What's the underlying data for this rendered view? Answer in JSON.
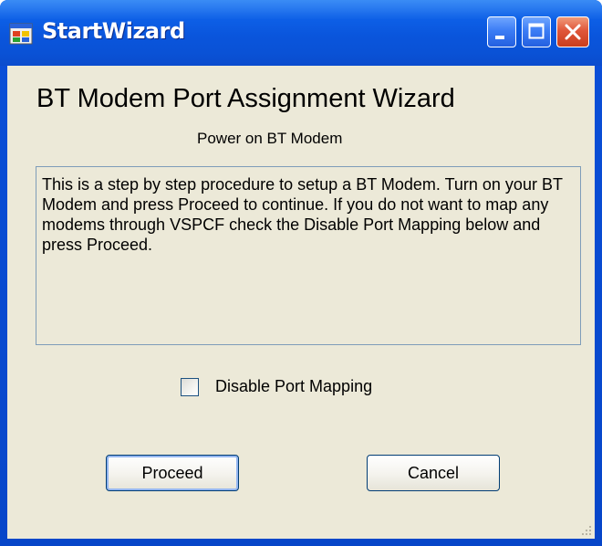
{
  "window": {
    "title": "StartWizard"
  },
  "title_buttons": {
    "minimize_icon": "minimize-icon",
    "maximize_icon": "maximize-icon",
    "close_icon": "close-icon"
  },
  "content": {
    "heading": "BT Modem Port Assignment Wizard",
    "subheading": "Power on BT Modem",
    "description": "This is a step by step procedure to setup a BT Modem.  Turn on your BT Modem and press Proceed to continue.  If you do not want to map any modems through VSPCF check the Disable Port Mapping below and press Proceed.",
    "checkbox_label": "Disable Port Mapping",
    "checkbox_checked": false
  },
  "buttons": {
    "proceed_label": "Proceed",
    "cancel_label": "Cancel"
  },
  "colors": {
    "titlebar": "#0a55dc",
    "client_background": "#ece9d8",
    "close_button": "#e0573a"
  }
}
